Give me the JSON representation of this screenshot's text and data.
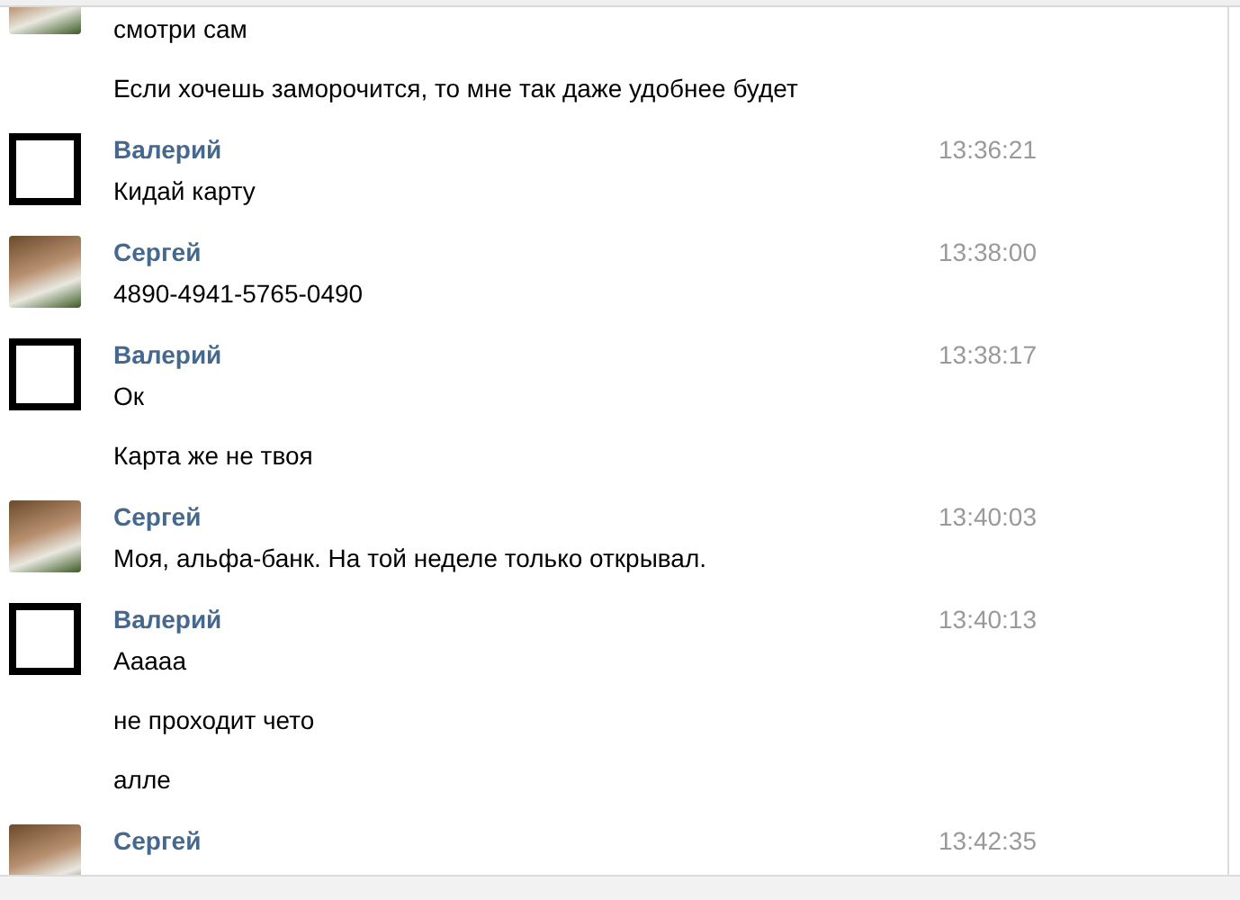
{
  "messages": [
    {
      "kind": "photo",
      "texts": [
        "смотри сам",
        "Если хочешь заморочится, то мне так даже удобнее будет"
      ]
    },
    {
      "author": "Валерий",
      "kind": "blank",
      "time": "13:36:21",
      "texts": [
        "Кидай карту"
      ]
    },
    {
      "author": "Сергей",
      "kind": "photo",
      "time": "13:38:00",
      "texts": [
        "4890-4941-5765-0490"
      ]
    },
    {
      "author": "Валерий",
      "kind": "blank",
      "time": "13:38:17",
      "texts": [
        "Ок",
        "Карта же не твоя"
      ]
    },
    {
      "author": "Сергей",
      "kind": "photo",
      "time": "13:40:03",
      "texts": [
        "Моя, альфа-банк. На той неделе только открывал."
      ]
    },
    {
      "author": "Валерий",
      "kind": "blank",
      "time": "13:40:13",
      "texts": [
        "Аaaaa",
        "не проходит чето",
        "алле"
      ]
    },
    {
      "author": "Сергей",
      "kind": "photo",
      "time": "13:42:35"
    }
  ]
}
